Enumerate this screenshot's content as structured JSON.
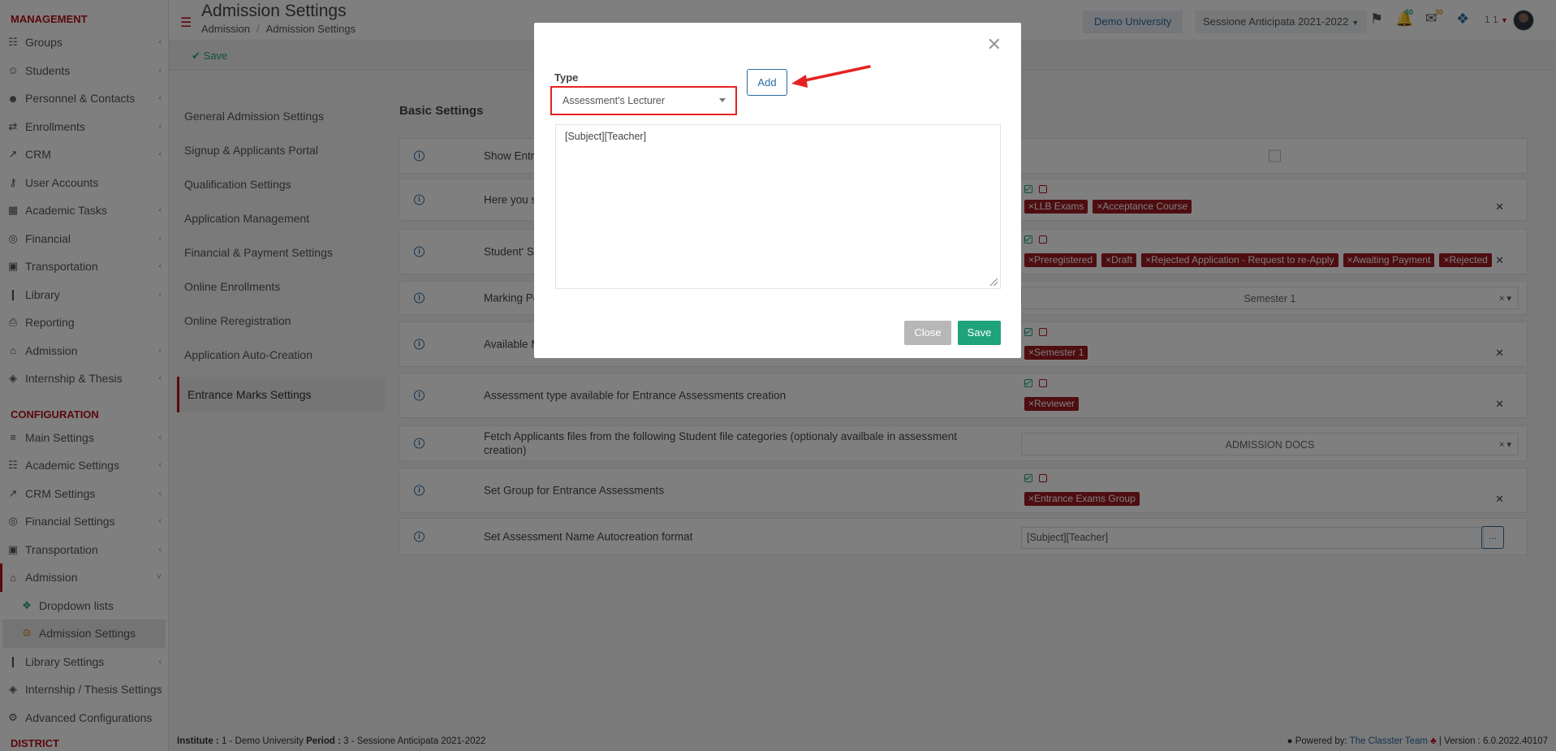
{
  "sidebar": {
    "management_title": "MANAGEMENT",
    "management": [
      {
        "label": "Groups",
        "icon": "groups-icon"
      },
      {
        "label": "Students",
        "icon": "students-icon"
      },
      {
        "label": "Personnel & Contacts",
        "icon": "personnel-icon"
      },
      {
        "label": "Enrollments",
        "icon": "enrollments-icon"
      },
      {
        "label": "CRM",
        "icon": "crm-icon"
      },
      {
        "label": "User Accounts",
        "icon": "key-icon"
      },
      {
        "label": "Academic Tasks",
        "icon": "tasks-icon"
      },
      {
        "label": "Financial",
        "icon": "coins-icon"
      },
      {
        "label": "Transportation",
        "icon": "bus-icon"
      },
      {
        "label": "Library",
        "icon": "library-icon"
      },
      {
        "label": "Reporting",
        "icon": "printer-icon"
      },
      {
        "label": "Admission",
        "icon": "bank-icon"
      },
      {
        "label": "Internship & Thesis",
        "icon": "box-icon"
      }
    ],
    "configuration_title": "CONFIGURATION",
    "configuration": [
      {
        "label": "Main Settings",
        "icon": "sliders-icon"
      },
      {
        "label": "Academic Settings",
        "icon": "groups-icon"
      },
      {
        "label": "CRM Settings",
        "icon": "crm-icon"
      },
      {
        "label": "Financial Settings",
        "icon": "coins-icon"
      },
      {
        "label": "Transportation",
        "icon": "bus-icon"
      },
      {
        "label": "Admission",
        "icon": "bank-icon"
      },
      {
        "label": "Dropdown lists",
        "icon": "layers-icon"
      },
      {
        "label": "Admission Settings",
        "icon": "gear-icon"
      },
      {
        "label": "Library Settings",
        "icon": "library-icon"
      },
      {
        "label": "Internship / Thesis Settings",
        "icon": "box-icon"
      },
      {
        "label": "Advanced Configurations",
        "icon": "cogs-icon"
      }
    ],
    "district_title": "DISTRICT"
  },
  "header": {
    "title": "Admission Settings",
    "breadcrumb": [
      "Admission",
      "Admission Settings"
    ],
    "university": "Demo University",
    "period": "Sessione Anticipata 2021-2022",
    "notifications_count": "60",
    "messages_count": "30",
    "user": "1 1"
  },
  "toolbar": {
    "save_label": "Save"
  },
  "settings_menu": [
    "General Admission Settings",
    "Signup & Applicants Portal",
    "Qualification Settings",
    "Application Management",
    "Financial & Payment Settings",
    "Online Enrollments",
    "Online Reregistration",
    "Application Auto-Creation",
    "Entrance Marks Settings"
  ],
  "basic_settings": {
    "title": "Basic Settings",
    "rows": [
      {
        "label": "Show Entra"
      },
      {
        "label": "Here you s",
        "tags": [
          "LLB Exams",
          "Acceptance Course"
        ]
      },
      {
        "label": "Student' St",
        "tags": [
          "Preregistered",
          "Draft",
          "Rejected Application - Request to re-Apply",
          "Awaiting Payment",
          "Rejected"
        ]
      },
      {
        "label": "Marking Pe",
        "select": "Semester 1"
      },
      {
        "label": "Available M",
        "tags": [
          "Semester 1"
        ]
      },
      {
        "label": "Assessment type available for Entrance Assessments creation",
        "tags": [
          "Reviewer"
        ]
      },
      {
        "label": "Fetch Applicants files from the following Student file categories (optionaly availbale in assessment creation)",
        "select": "ADMISSION DOCS"
      },
      {
        "label": "Set Group for Entrance Assessments",
        "tags": [
          "Entrance Exams Group"
        ]
      },
      {
        "label": "Set Assessment Name Autocreation format",
        "input": "[Subject][Teacher]",
        "button": "..."
      }
    ]
  },
  "footer": {
    "institute_label": "Institute :",
    "institute_value": " 1 - Demo University ",
    "period_label": "Period :",
    "period_value": " 3 - Sessione Anticipata 2021-2022",
    "powered": "Powered by:",
    "team": "The Classter Team",
    "version": "| Version : 6.0.2022.40107"
  },
  "modal": {
    "type_label": "Type",
    "type_value": "Assessment's Lecturer",
    "add_label": "Add",
    "textarea_value": "[Subject][Teacher]",
    "close_label": "Close",
    "save_label": "Save"
  },
  "colors": {
    "brand_red": "#b5121b",
    "tag_red": "#9c1a20",
    "save_green": "#1fa37a",
    "link_blue": "#2c6aa0",
    "highlight_red": "#e52222"
  }
}
